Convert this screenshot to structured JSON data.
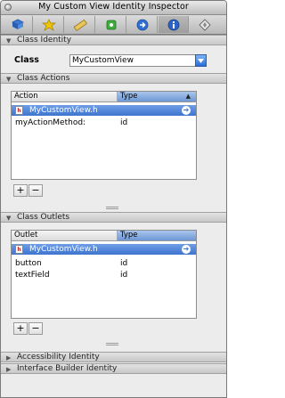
{
  "window": {
    "title": "My Custom View Identity Inspector"
  },
  "toolbar": {
    "tabs": [
      {
        "icon": "attributes-icon"
      },
      {
        "icon": "effects-icon"
      },
      {
        "icon": "size-ruler-icon"
      },
      {
        "icon": "connections-icon"
      },
      {
        "icon": "bindings-arrow-icon"
      },
      {
        "icon": "identity-info-icon",
        "selected": true
      },
      {
        "icon": "applescript-icon"
      }
    ]
  },
  "sections": {
    "class_identity": "Class Identity",
    "class_actions": "Class Actions",
    "class_outlets": "Class Outlets",
    "accessibility": "Accessibility Identity",
    "interface_builder": "Interface Builder Identity"
  },
  "class_identity": {
    "label": "Class",
    "value": "MyCustomView"
  },
  "actions_table": {
    "col1": "Action",
    "col2": "Type",
    "group": "MyCustomView.h",
    "rows": [
      {
        "name": "myActionMethod:",
        "type": "id"
      }
    ]
  },
  "outlets_table": {
    "col1": "Outlet",
    "col2": "Type",
    "group": "MyCustomView.h",
    "rows": [
      {
        "name": "button",
        "type": "id"
      },
      {
        "name": "textField",
        "type": "id"
      }
    ]
  },
  "buttons": {
    "add": "+",
    "remove": "−"
  },
  "colors": {
    "selection": "#3e74cf",
    "accent": "#2a6cd4"
  }
}
